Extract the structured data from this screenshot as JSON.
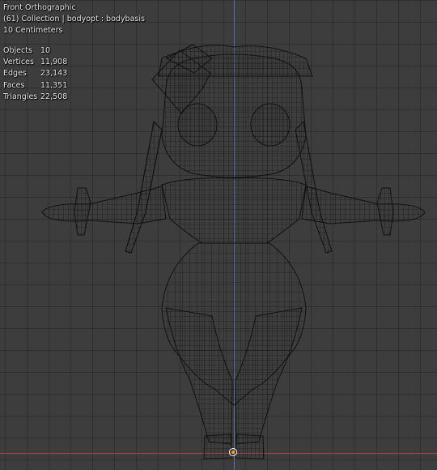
{
  "viewport": {
    "view_name": "Front Orthographic",
    "collection_line": "(61) Collection | bodyopt : bodybasis",
    "scale_label": "10 Centimeters"
  },
  "stats": [
    {
      "label": "Objects",
      "value": "10"
    },
    {
      "label": "Vertices",
      "value": "11,908"
    },
    {
      "label": "Edges",
      "value": "23,143"
    },
    {
      "label": "Faces",
      "value": "11,351"
    },
    {
      "label": "Triangles",
      "value": "22,508"
    }
  ],
  "colors": {
    "background": "#3d3d3d",
    "wire": "#111111",
    "axis_x": "#b5424a",
    "axis_z": "#4f7ac0",
    "origin": "#f5a623"
  }
}
